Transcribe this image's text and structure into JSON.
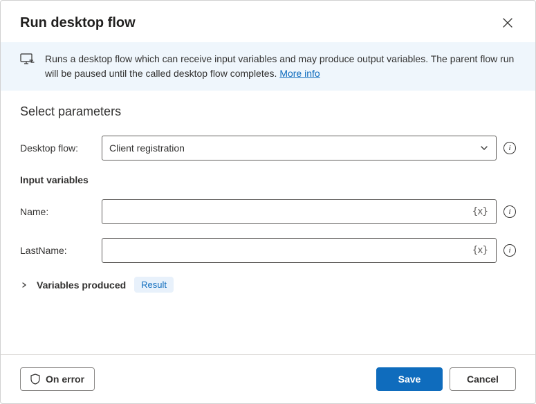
{
  "header": {
    "title": "Run desktop flow"
  },
  "banner": {
    "text_prefix": "Runs a desktop flow which can receive input variables and may produce output variables. The parent flow run will be paused until the called desktop flow completes. ",
    "more_info": "More info"
  },
  "params": {
    "section_title": "Select parameters",
    "desktop_flow_label": "Desktop flow:",
    "desktop_flow_value": "Client registration",
    "input_vars_heading": "Input variables",
    "inputs": [
      {
        "label": "Name:",
        "value": ""
      },
      {
        "label": "LastName:",
        "value": ""
      }
    ],
    "variables_produced_label": "Variables produced",
    "result_chip": "Result",
    "variable_token": "{x}"
  },
  "footer": {
    "on_error": "On error",
    "save": "Save",
    "cancel": "Cancel"
  },
  "info_glyph": "i"
}
